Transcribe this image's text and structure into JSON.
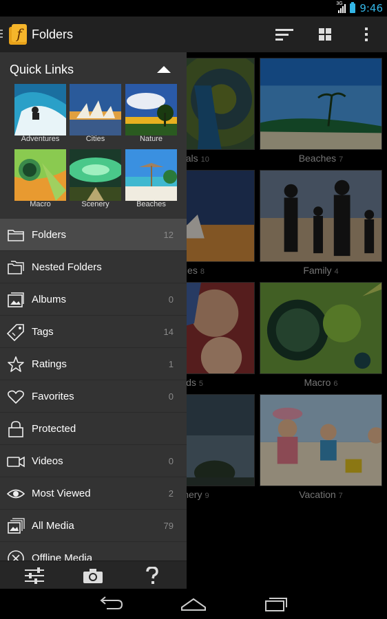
{
  "status_bar": {
    "network": "3G",
    "time": "9:46"
  },
  "action_bar": {
    "title": "Folders",
    "icons": [
      "sort-icon",
      "grid-view-icon",
      "overflow-menu-icon"
    ]
  },
  "quick_links": {
    "title": "Quick Links",
    "items": [
      {
        "label": "Adventures"
      },
      {
        "label": "Cities"
      },
      {
        "label": "Nature"
      },
      {
        "label": "Macro"
      },
      {
        "label": "Scenery"
      },
      {
        "label": "Beaches"
      }
    ]
  },
  "menu": [
    {
      "label": "Folders",
      "count": "12",
      "icon": "folder-icon"
    },
    {
      "label": "Nested Folders",
      "count": "",
      "icon": "nested-folders-icon"
    },
    {
      "label": "Albums",
      "count": "0",
      "icon": "album-icon"
    },
    {
      "label": "Tags",
      "count": "14",
      "icon": "tag-icon"
    },
    {
      "label": "Ratings",
      "count": "1",
      "icon": "star-icon"
    },
    {
      "label": "Favorites",
      "count": "0",
      "icon": "heart-icon"
    },
    {
      "label": "Protected",
      "count": "",
      "icon": "lock-icon"
    },
    {
      "label": "Videos",
      "count": "0",
      "icon": "video-icon"
    },
    {
      "label": "Most Viewed",
      "count": "2",
      "icon": "eye-icon"
    },
    {
      "label": "All Media",
      "count": "79",
      "icon": "all-media-icon"
    },
    {
      "label": "Offline Media",
      "count": "",
      "icon": "offline-icon"
    }
  ],
  "drawer_bottom": {
    "icons": [
      "settings-sliders-icon",
      "camera-icon",
      "help-icon"
    ]
  },
  "grid": [
    {
      "caption": "mals",
      "count": "10"
    },
    {
      "caption": "Beaches",
      "count": "7"
    },
    {
      "caption": "ties",
      "count": "8"
    },
    {
      "caption": "Family",
      "count": "4"
    },
    {
      "caption": "ids",
      "count": "5"
    },
    {
      "caption": "Macro",
      "count": "6"
    },
    {
      "caption": "enery",
      "count": "9"
    },
    {
      "caption": "Vacation",
      "count": "7"
    }
  ],
  "nav_bar": {
    "icons": [
      "back-icon",
      "home-icon",
      "recents-icon"
    ]
  },
  "colors": {
    "accent": "#33b5e5",
    "drawer": "#333333",
    "actionbar": "#212121",
    "active_item": "#4a4a4a"
  }
}
